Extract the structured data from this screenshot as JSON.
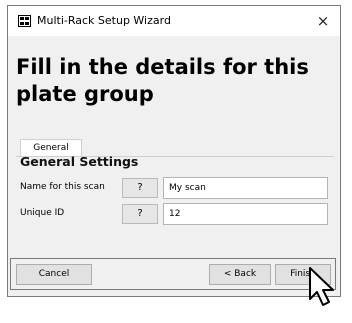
{
  "window": {
    "title": "Multi-Rack Setup Wizard",
    "close_symbol": "×"
  },
  "page": {
    "heading": "Fill in the details for this plate group"
  },
  "tabs": [
    {
      "label": "General",
      "selected": true
    }
  ],
  "section": {
    "title": "General Settings"
  },
  "fields": [
    {
      "label": "Name for this scan",
      "help": "?",
      "value": "My scan"
    },
    {
      "label": "Unique ID",
      "help": "?",
      "value": "12"
    }
  ],
  "buttons": {
    "cancel": "Cancel",
    "back": "< Back",
    "finish": "Finish"
  },
  "icons": {
    "app": "multi-rack-app-icon",
    "close": "close-icon",
    "cursor": "mouse-pointer-icon"
  }
}
